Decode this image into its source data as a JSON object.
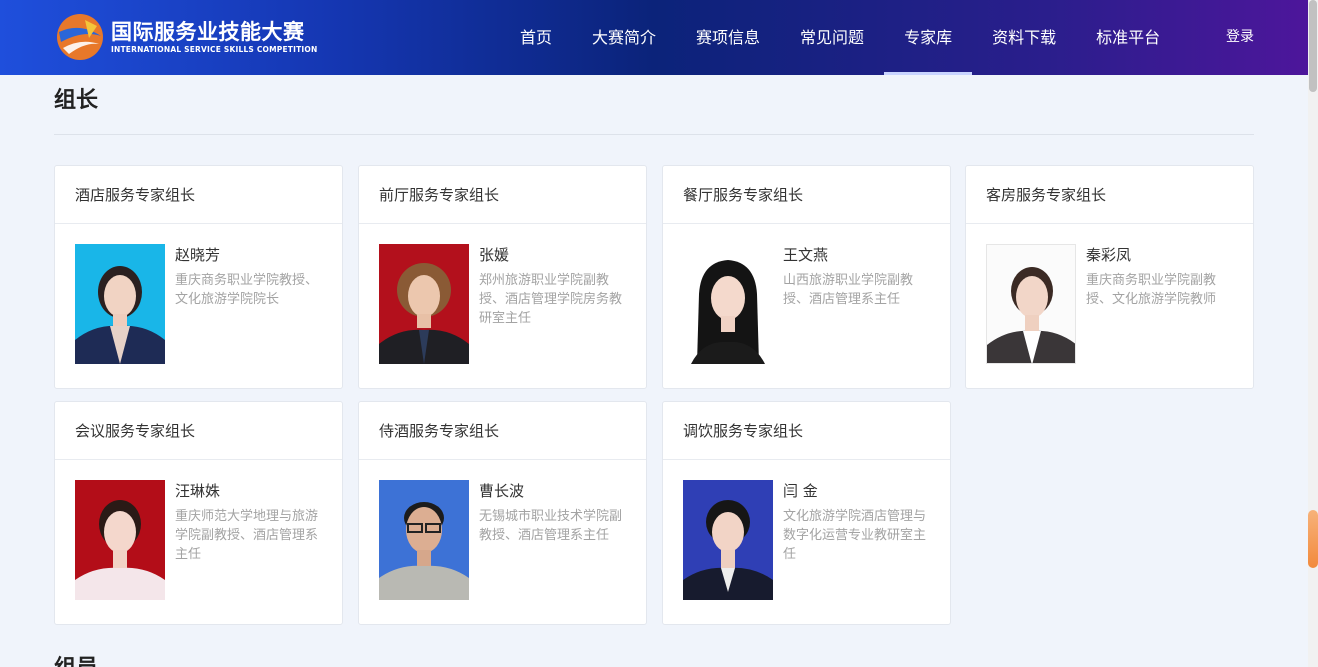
{
  "header": {
    "logo_cn": "国际服务业技能大赛",
    "logo_en": "INTERNATIONAL SERVICE SKILLS COMPETITION",
    "nav": [
      {
        "label": "首页"
      },
      {
        "label": "大赛简介"
      },
      {
        "label": "赛项信息"
      },
      {
        "label": "常见问题"
      },
      {
        "label": "专家库"
      },
      {
        "label": "资料下载"
      },
      {
        "label": "标准平台"
      }
    ],
    "active_nav": "专家库",
    "login_label": "登录"
  },
  "section": {
    "title": "组长",
    "next_title": "组员"
  },
  "cards": [
    {
      "title": "酒店服务专家组长",
      "name": "赵晓芳",
      "desc": "重庆商务职业学院教授、文化旅游学院院长"
    },
    {
      "title": "前厅服务专家组长",
      "name": "张媛",
      "desc": "郑州旅游职业学院副教授、酒店管理学院房务教研室主任"
    },
    {
      "title": "餐厅服务专家组长",
      "name": "王文燕",
      "desc": "山西旅游职业学院副教授、酒店管理系主任"
    },
    {
      "title": "客房服务专家组长",
      "name": "秦彩凤",
      "desc": "重庆商务职业学院副教授、文化旅游学院教师"
    },
    {
      "title": "会议服务专家组长",
      "name": "汪琳姝",
      "desc": "重庆师范大学地理与旅游学院副教授、酒店管理系主任"
    },
    {
      "title": "侍酒服务专家组长",
      "name": "曹长波",
      "desc": "无锡城市职业技术学院副教授、酒店管理系主任"
    },
    {
      "title": "调饮服务专家组长",
      "name": "闫 金",
      "desc": "文化旅游学院酒店管理与数字化运营专业教研室主任"
    }
  ],
  "colors": {
    "header_start": "#1f4fdc",
    "header_end": "#4d169b",
    "page_bg": "#f0f4fb",
    "desc_text": "#a3a3a3"
  }
}
